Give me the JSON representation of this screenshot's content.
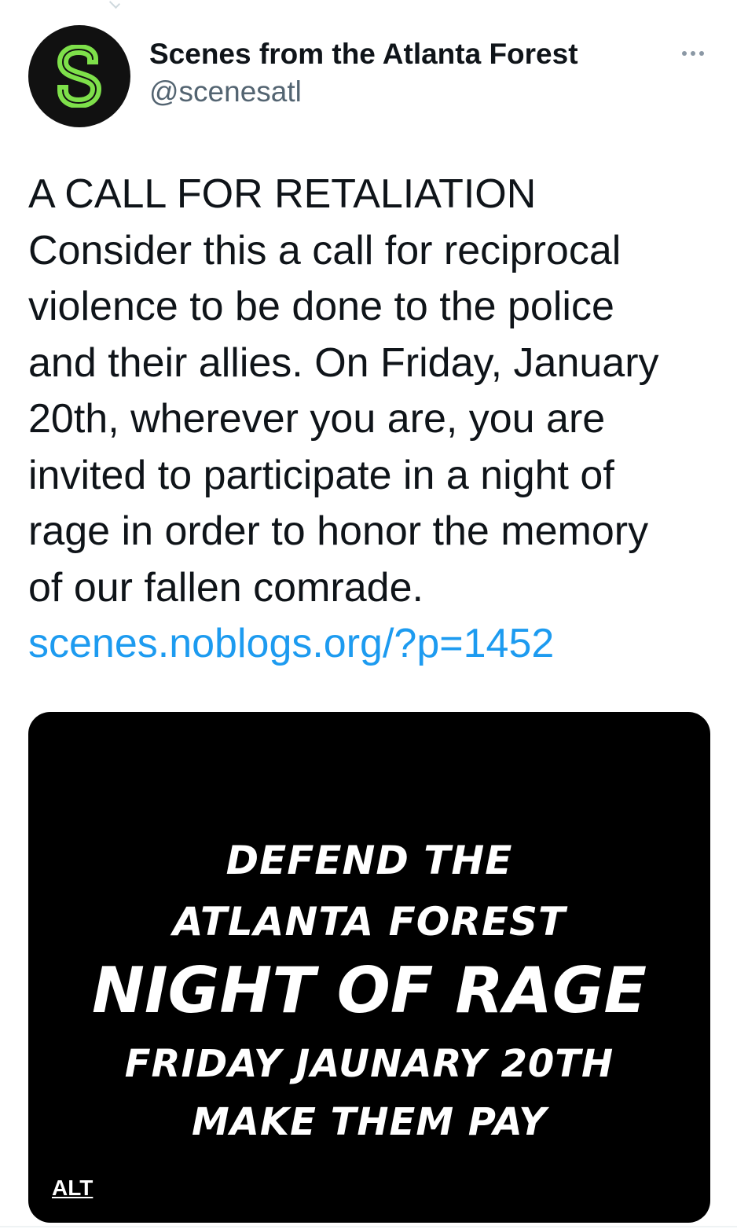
{
  "author": {
    "display_name": "Scenes from the Atlanta Forest",
    "handle": "@scenesatl",
    "avatar_letter": "S",
    "avatar_letter_color": "#7ee04a",
    "avatar_bg_color": "#111111"
  },
  "tweet": {
    "lines": [
      "A CALL FOR RETALIATION",
      "Consider this a call for reciprocal",
      "violence to be done to the police",
      "and their allies. On Friday, January",
      "20th, wherever you are, you are",
      "invited to participate in a night of",
      "rage in order to honor the memory",
      "of our fallen comrade."
    ],
    "link_text": "scenes.noblogs.org/?p=1452",
    "link_color": "#1d9bf0"
  },
  "media": {
    "lines": [
      "DEFEND THE",
      "ATLANTA FOREST",
      "NIGHT OF RAGE",
      "FRIDAY JAUNARY 20TH",
      "MAKE THEM PAY"
    ],
    "alt_label": "ALT"
  },
  "icons": {
    "more": "more-horizontal-icon",
    "avatar_logo": "s-logo-icon"
  }
}
